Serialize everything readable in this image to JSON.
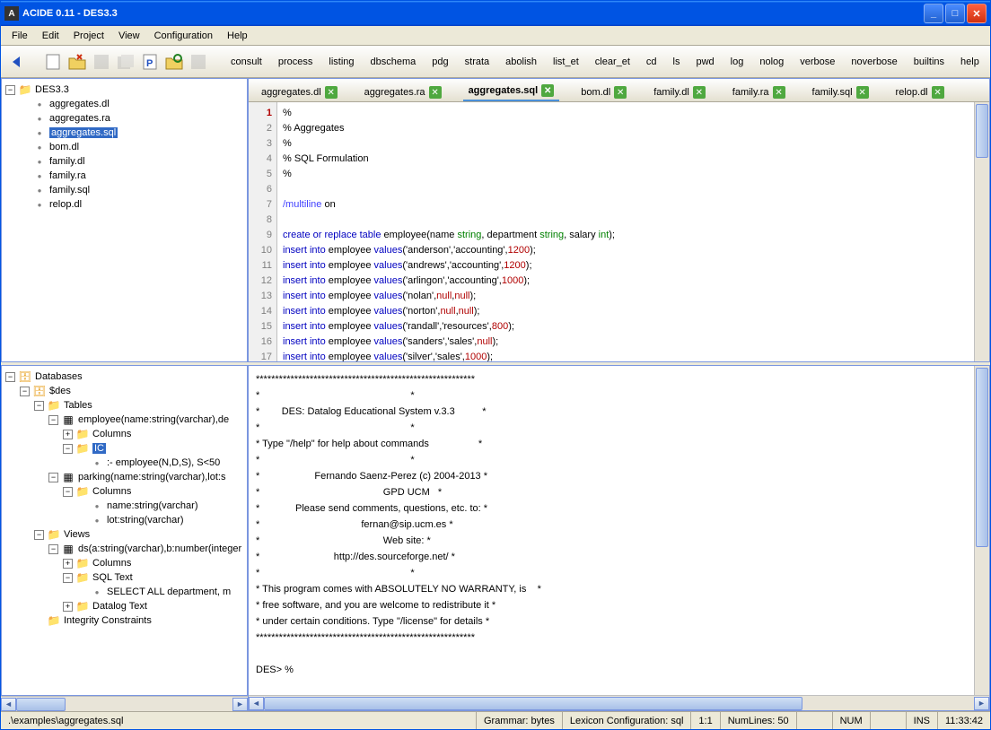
{
  "titlebar": {
    "icon": "A",
    "text": "ACIDE 0.11 - DES3.3"
  },
  "menubar": [
    "File",
    "Edit",
    "Project",
    "View",
    "Configuration",
    "Help"
  ],
  "toolbar_text": [
    "consult",
    "process",
    "listing",
    "dbschema",
    "pdg",
    "strata",
    "abolish",
    "list_et",
    "clear_et",
    "cd",
    "ls",
    "pwd",
    "log",
    "nolog",
    "verbose",
    "noverbose",
    "builtins",
    "help"
  ],
  "project_tree": {
    "root": "DES3.3",
    "files": [
      "aggregates.dl",
      "aggregates.ra",
      "aggregates.sql",
      "bom.dl",
      "family.dl",
      "family.ra",
      "family.sql",
      "relop.dl"
    ],
    "selected": "aggregates.sql"
  },
  "tabs": [
    {
      "label": "aggregates.dl",
      "active": false
    },
    {
      "label": "aggregates.ra",
      "active": false
    },
    {
      "label": "aggregates.sql",
      "active": true
    },
    {
      "label": "bom.dl",
      "active": false
    },
    {
      "label": "family.dl",
      "active": false
    },
    {
      "label": "family.ra",
      "active": false
    },
    {
      "label": "family.sql",
      "active": false
    },
    {
      "label": "relop.dl",
      "active": false
    }
  ],
  "editor": {
    "lines": [
      "%",
      "% Aggregates",
      "%",
      "% SQL Formulation",
      "%",
      "",
      "/multiline on",
      "",
      "create or replace table employee(name string, department string, salary int);",
      "insert into employee values('anderson','accounting',1200);",
      "insert into employee values('andrews','accounting',1200);",
      "insert into employee values('arlingon','accounting',1000);",
      "insert into employee values('nolan',null,null);",
      "insert into employee values('norton',null,null);",
      "insert into employee values('randall','resources',800);",
      "insert into employee values('sanders','sales',null);",
      "insert into employee values('silver','sales',1000);"
    ],
    "current_line": 1,
    "total_lines": 50
  },
  "db_tree": {
    "root": "Databases",
    "db": "$des",
    "tables_label": "Tables",
    "employee": "employee(name:string(varchar),de",
    "columns_label": "Columns",
    "ic_label": "IC",
    "ic_rule": ":- employee(N,D,S), S<50",
    "parking": "parking(name:string(varchar),lot:s",
    "park_cols": [
      "name:string(varchar)",
      "lot:string(varchar)"
    ],
    "views_label": "Views",
    "view_ds": "ds(a:string(varchar),b:number(integer",
    "sqltext_label": "SQL Text",
    "sqltext_val": "SELECT ALL department, m",
    "dltext_label": "Datalog Text",
    "ic_constraints": "Integrity Constraints"
  },
  "console": {
    "l1": "*********************************************************",
    "l2": "*                                                       *",
    "l3": "*        DES: Datalog Educational System v.3.3          *",
    "l4": "*                                                       *",
    "l5": "* Type \"/help\" for help about commands                  *",
    "l6": "*                                                       *",
    "l7": "*                    Fernando Saenz-Perez (c) 2004-2013 *",
    "l8": "*                                             GPD UCM   *",
    "l9": "*             Please send comments, questions, etc. to: *",
    "l10": "*                                     fernan@sip.ucm.es *",
    "l11": "*                                             Web site: *",
    "l12": "*                           http://des.sourceforge.net/ *",
    "l13": "*                                                       *",
    "l14": "* This program comes with ABSOLUTELY NO WARRANTY, is    *",
    "l15": "* free software, and you are welcome to redistribute it *",
    "l16": "* under certain conditions. Type \"/license\" for details *",
    "l17": "*********************************************************",
    "l18": "",
    "l19": "DES> %"
  },
  "statusbar": {
    "path": ".\\examples\\aggregates.sql",
    "grammar": "Grammar: bytes",
    "lexicon": "Lexicon Configuration: sql",
    "pos": "1:1",
    "numlines": "NumLines: 50",
    "num": "NUM",
    "ins": "INS",
    "time": "11:33:42"
  }
}
